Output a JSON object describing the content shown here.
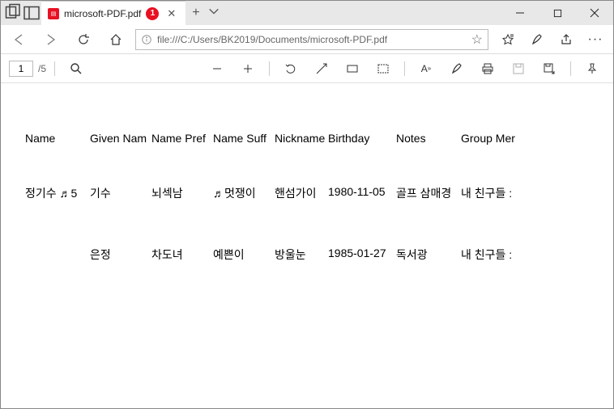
{
  "tab": {
    "title": "microsoft-PDF.pdf",
    "badge": "1"
  },
  "url": "file:///C:/Users/BK2019/Documents/microsoft-PDF.pdf",
  "page": {
    "current": "1",
    "total": "/5"
  },
  "headers": [
    "Name",
    "Given Nam",
    "Name Pref",
    "Name Suff",
    "Nickname",
    "Birthday",
    "Notes",
    "Group Mer"
  ],
  "rows": [
    [
      "정기수 ♬5",
      "기수",
      "뇌섹남",
      "♬멋쟁이",
      "핸섬가이",
      "1980-11-05",
      "골프 삼매경",
      "내 친구들 :"
    ],
    [
      "",
      "은정",
      "차도녀",
      "예쁜이",
      "방울눈",
      "1985-01-27",
      "독서광",
      "내 친구들 :"
    ]
  ]
}
